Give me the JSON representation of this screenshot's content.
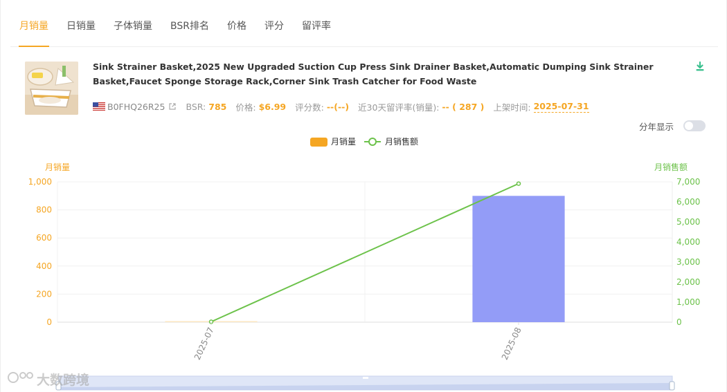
{
  "tabs": [
    {
      "label": "月销量",
      "active": true
    },
    {
      "label": "日销量",
      "active": false
    },
    {
      "label": "子体销量",
      "active": false
    },
    {
      "label": "BSR排名",
      "active": false
    },
    {
      "label": "价格",
      "active": false
    },
    {
      "label": "评分",
      "active": false
    },
    {
      "label": "留评率",
      "active": false
    }
  ],
  "product": {
    "title": "Sink Strainer Basket,2025 New Upgraded Suction Cup Press Sink Drainer Basket,Automatic Dumping Sink Strainer Basket,Faucet Sponge Storage Rack,Corner Sink Trash Catcher for Food Waste",
    "asin": "B0FHQ26R25",
    "bsr_label": "BSR:",
    "bsr_value": "785",
    "price_label": "价格:",
    "price_value": "$6.99",
    "rating_label": "评分数:",
    "rating_value": "--(--)",
    "review_rate_label": "近30天留评率(销量):",
    "review_rate_value": "-- ( 287 )",
    "listed_label": "上架时间:",
    "listed_value": "2025-07-31"
  },
  "controls": {
    "year_toggle_label": "分年显示",
    "year_toggle_on": false
  },
  "watermark": "大数跨境",
  "colors": {
    "accent": "#f5a623",
    "bar": "#939cf7",
    "bar_faint": "#fce7c2",
    "line": "#6cc24a",
    "download": "#3cc08f"
  },
  "chart_data": {
    "type": "bar",
    "legend": [
      "月销量",
      "月销售额"
    ],
    "legend_position": "top-center",
    "categories": [
      "2025-07",
      "2025-08"
    ],
    "series": [
      {
        "name": "月销量",
        "type": "bar",
        "axis": "left",
        "values": [
          3,
          900
        ]
      },
      {
        "name": "月销售额",
        "type": "line",
        "axis": "right",
        "values": [
          21,
          6910
        ]
      }
    ],
    "y_left": {
      "label": "月销量",
      "min": 0,
      "max": 1000,
      "ticks": [
        0,
        200,
        400,
        600,
        800,
        1000
      ],
      "tick_labels": [
        "0",
        "200",
        "400",
        "600",
        "800",
        "1,000"
      ]
    },
    "y_right": {
      "label": "月销售额",
      "min": 0,
      "max": 7000,
      "ticks": [
        0,
        1000,
        2000,
        3000,
        4000,
        5000,
        6000,
        7000
      ],
      "tick_labels": [
        "0",
        "1,000",
        "2,000",
        "3,000",
        "4,000",
        "5,000",
        "6,000",
        "7,000"
      ]
    },
    "grid": true
  }
}
